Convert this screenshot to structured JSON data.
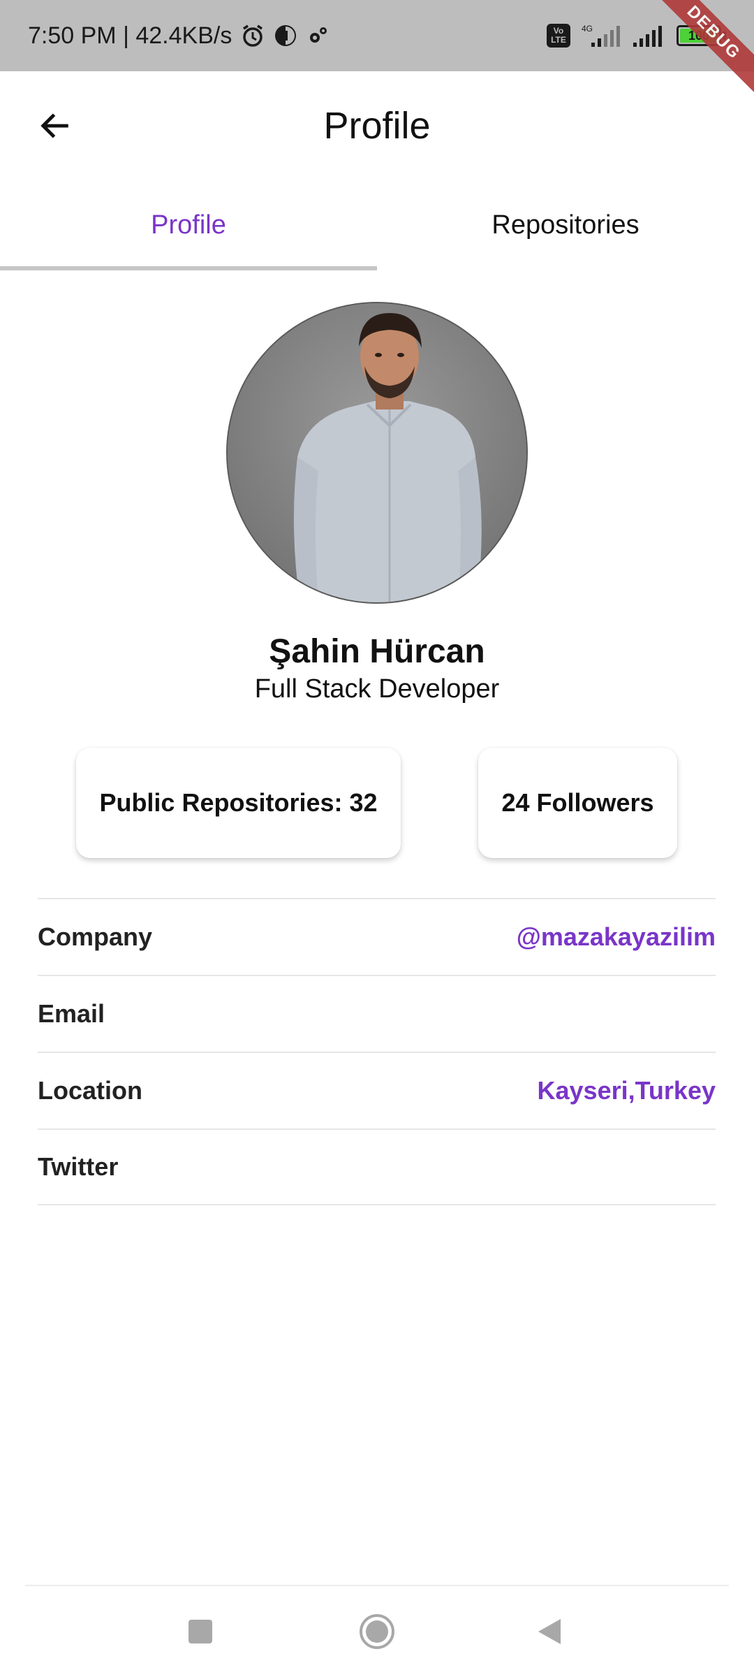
{
  "status_bar": {
    "time_speed": "7:50 PM | 42.4KB/s",
    "volte": "Vo\nLTE",
    "network": "4G",
    "battery": "100"
  },
  "debug_banner": "DEBUG",
  "app_bar": {
    "title": "Profile"
  },
  "tabs": [
    {
      "label": "Profile",
      "active": true
    },
    {
      "label": "Repositories",
      "active": false
    }
  ],
  "profile": {
    "name": "Şahin Hürcan",
    "role": "Full Stack Developer"
  },
  "stats": {
    "public_repos": "Public Repositories: 32",
    "followers": "24 Followers"
  },
  "info": [
    {
      "label": "Company",
      "value": "@mazakayazilim"
    },
    {
      "label": "Email",
      "value": ""
    },
    {
      "label": "Location",
      "value": "Kayseri,Turkey"
    },
    {
      "label": "Twitter",
      "value": ""
    }
  ],
  "colors": {
    "accent": "#7a35c8",
    "status_bar_bg": "#bdbdbd"
  }
}
